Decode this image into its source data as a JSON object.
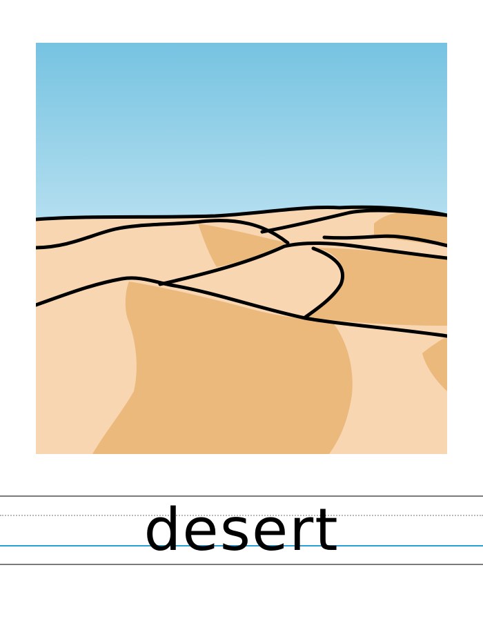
{
  "card": {
    "word": "desert",
    "illustration": {
      "subject": "desert-dunes",
      "colors": {
        "sky_top": "#76c3e1",
        "sky_bottom": "#b5dff0",
        "sand_light": "#f8d6b1",
        "sand_shadow": "#ebb97c",
        "outline": "#000000"
      }
    }
  },
  "guide_colors": {
    "outer_lines": "#7a7a7a",
    "midline": "#b8b8b8",
    "baseline": "#2a9fd6"
  }
}
